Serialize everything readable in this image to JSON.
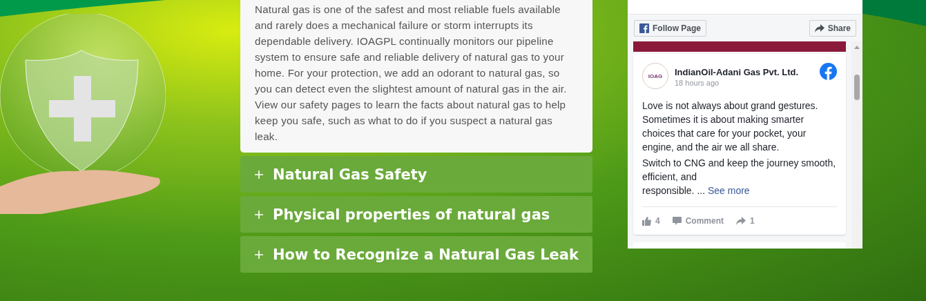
{
  "info_card": {
    "text": "Natural gas is one of the safest and most reliable fuels available and rarely does a mechanical failure or storm interrupts its dependable delivery. IOAGPL continually monitors our pipeline system to ensure safe and reliable delivery of natural gas to your home. For your protection, we add an odorant to natural gas, so you can detect even the slightest amount of natural gas in the air. View our safety pages to learn the facts about natural gas to help keep you safe, such as what to do if you suspect a natural gas leak."
  },
  "accordion": [
    {
      "label": "Natural Gas Safety",
      "expanded": false
    },
    {
      "label": "Physical properties of natural gas",
      "expanded": false
    },
    {
      "label": "How to Recognize a Natural Gas Leak",
      "expanded": false
    }
  ],
  "facebook_widget": {
    "follow_button": "Follow Page",
    "share_button": "Share",
    "post": {
      "avatar_text": "IOAG",
      "page_name": "IndianOil-Adani Gas Pvt. Ltd.",
      "time": "18 hours ago",
      "paragraphs": [
        "Love is not always about grand gestures. Sometimes it is about making smarter choices that care for your pocket, your engine, and the air we all share.",
        "Switch to CNG and keep the journey smooth, efficient, and\nresponsible. ..."
      ],
      "see_more": "See more",
      "likes": "4",
      "comment_label": "Comment",
      "shares": "1"
    }
  }
}
